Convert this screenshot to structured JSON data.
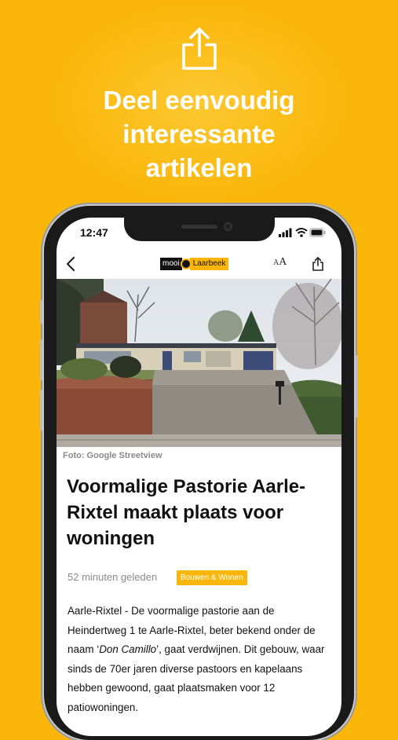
{
  "promo": {
    "headline_line1": "Deel eenvoudig",
    "headline_line2": "interessante",
    "headline_line3": "artikelen",
    "background_color": "#FAB609",
    "icon": "share-icon"
  },
  "status_bar": {
    "time": "12:47",
    "icons": [
      "signal-icon",
      "wifi-icon",
      "battery-icon"
    ]
  },
  "navbar": {
    "logo_left": "mooi",
    "logo_right": "Laarbeek",
    "font_size_label": "A",
    "font_size_label_small": "A",
    "icons": [
      "back-icon",
      "font-size-icon",
      "share-icon"
    ]
  },
  "article": {
    "photo_caption": "Foto: Google Streetview",
    "title": "Voormalige Pastorie Aarle-Rixtel maakt plaats voor woningen",
    "time_ago": "52 minuten geleden",
    "category": "Bouwen & Wonen",
    "body_part1": "Aarle-Rixtel - De voormalige pastorie aan de Heindertweg 1 te Aarle-Rixtel, beter bekend onder de naam ‘",
    "body_emphasis": "Don Camillo",
    "body_part2": "’, gaat verdwijnen. Dit gebouw, waar sinds de 70er jaren diverse pastoors en kapelaans hebben gewoond, gaat plaatsmaken voor 12 patiowoningen."
  }
}
